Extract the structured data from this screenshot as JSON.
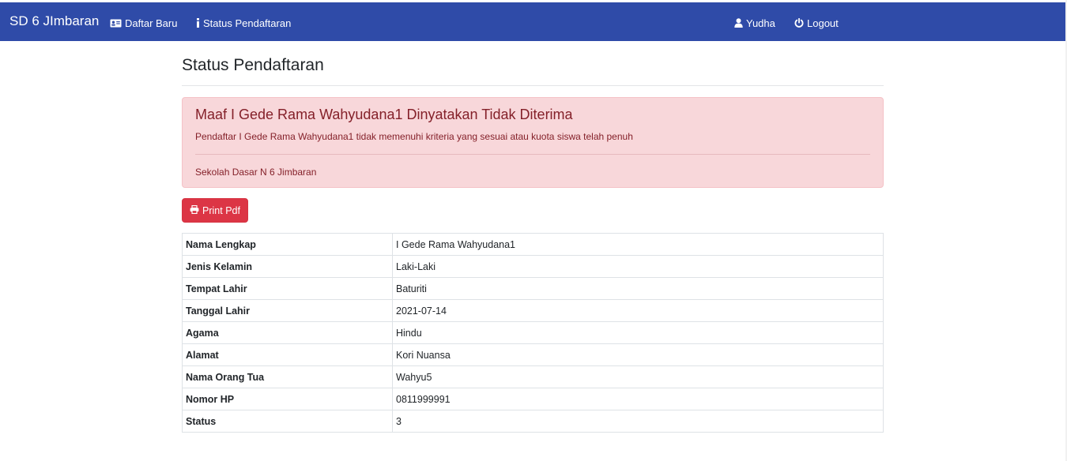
{
  "navbar": {
    "brand": "SD 6 JImbaran",
    "daftar_baru": "Daftar Baru",
    "status_pendaftaran": "Status Pendaftaran",
    "user": "Yudha",
    "logout": "Logout",
    "bg_color": "#2f4ba8"
  },
  "page": {
    "title": "Status Pendaftaran"
  },
  "alert": {
    "heading": "Maaf I Gede Rama Wahyudana1 Dinyatakan Tidak Diterima",
    "text": "Pendaftar I Gede Rama Wahyudana1 tidak memenuhi kriteria yang sesuai atau kuota siswa telah penuh",
    "footer": "Sekolah Dasar N 6 Jimbaran",
    "bg_color": "#f8d7da",
    "text_color": "#842029"
  },
  "print_button": {
    "label": "Print Pdf",
    "color": "#dc3545"
  },
  "details": [
    {
      "label": "Nama Lengkap",
      "value": "I Gede Rama Wahyudana1"
    },
    {
      "label": "Jenis Kelamin",
      "value": "Laki-Laki"
    },
    {
      "label": "Tempat Lahir",
      "value": "Baturiti"
    },
    {
      "label": "Tanggal Lahir",
      "value": "2021-07-14"
    },
    {
      "label": "Agama",
      "value": "Hindu"
    },
    {
      "label": "Alamat",
      "value": "Kori Nuansa"
    },
    {
      "label": "Nama Orang Tua",
      "value": "Wahyu5"
    },
    {
      "label": "Nomor HP",
      "value": "0811999991"
    },
    {
      "label": "Status",
      "value": "3"
    }
  ],
  "icons": {
    "daftar_baru": "id-card-icon",
    "status_pendaftaran": "info-icon",
    "user": "user-icon",
    "logout": "power-icon",
    "print": "printer-icon"
  }
}
